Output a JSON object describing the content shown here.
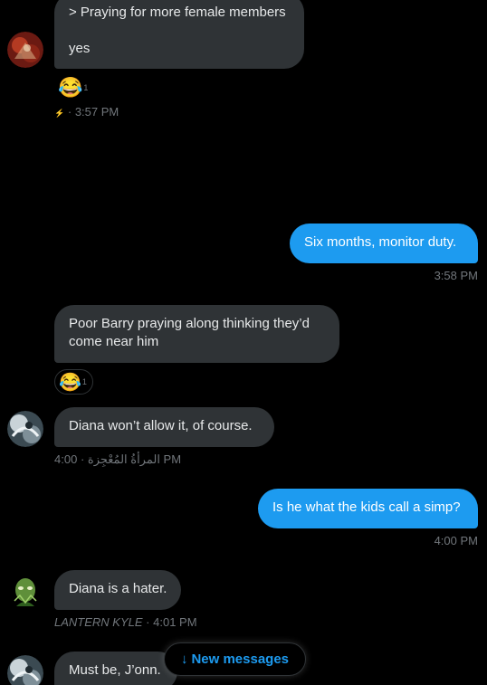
{
  "messages": [
    {
      "direction": "in",
      "lines": [
        "> Praying for more female members",
        "",
        "yes"
      ],
      "reaction": {
        "emoji": "😂",
        "count": "1"
      },
      "meta": {
        "icon": "bolt-icon",
        "icon_glyph": "⚡",
        "sep": "·",
        "time": "3:57 PM"
      }
    },
    {
      "direction": "out",
      "text": "Six months, monitor duty.",
      "meta": {
        "time": "3:58 PM"
      }
    },
    {
      "direction": "in",
      "lines": [
        "Poor Barry praying along thinking they’d",
        "come near him"
      ],
      "reaction": {
        "emoji": "😂",
        "count": "1"
      }
    },
    {
      "direction": "in",
      "text": "Diana won’t allow it, of course.",
      "meta": {
        "sender": "المرأةُ المُعْجِزة",
        "sep": "·",
        "time": "4:00 PM"
      }
    },
    {
      "direction": "out",
      "text": "Is he what the kids call a simp?",
      "meta": {
        "time": "4:00 PM"
      }
    },
    {
      "direction": "in",
      "text": "Diana is a hater.",
      "meta": {
        "sender": "LANTERN KYLE",
        "sep": "·",
        "time": "4:01 PM"
      }
    },
    {
      "direction": "in",
      "text": "Must be, J’onn."
    }
  ],
  "new_messages": {
    "arrow": "↓",
    "label": "New messages",
    "color": "#1d9bf0"
  },
  "colors": {
    "background": "#000000",
    "incoming_bubble": "#2f3336",
    "outgoing_bubble": "#1d9bf0",
    "meta_text": "#71767b"
  }
}
